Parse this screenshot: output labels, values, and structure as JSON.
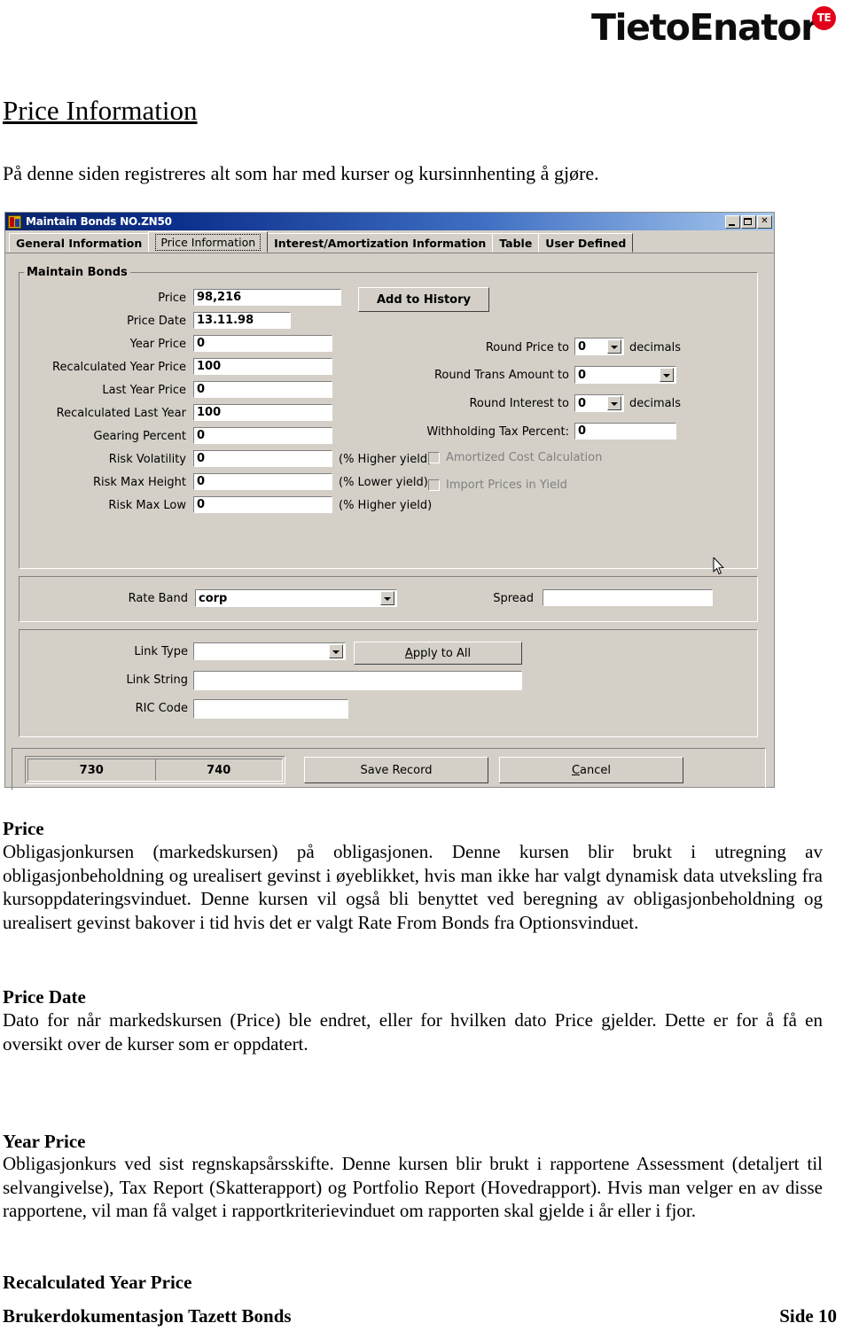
{
  "logo": {
    "wordmark": "TietoEnator",
    "badge": "TE"
  },
  "document": {
    "title": "Price Information",
    "intro": "På denne siden registreres alt som har med kurser og kursinnhenting å gjøre.",
    "sections": [
      {
        "heading": "Price",
        "body": "Obligasjonkursen (markedskursen) på obligasjonen. Denne kursen blir brukt i utregning av obligasjonbeholdning og urealisert gevinst i øyeblikket, hvis man ikke har valgt dynamisk data utveksling fra kursoppdateringsvinduet. Denne kursen vil også bli benyttet ved beregning av obligasjonbeholdning og urealisert gevinst bakover i tid hvis det er valgt Rate From Bonds fra Optionsvinduet."
      },
      {
        "heading": "Price Date",
        "body": "Dato for når markedskursen (Price) ble endret, eller for hvilken dato Price gjelder. Dette er for å få en oversikt over de kurser som er oppdatert."
      },
      {
        "heading": "Year Price",
        "body": "Obligasjonkurs ved sist regnskapsårsskifte. Denne kursen blir brukt i rapportene Assessment (detaljert til selvangivelse), Tax Report (Skatterapport) og Portfolio Report (Hovedrapport). Hvis man velger en av disse rapportene, vil man få valget i rapportkriterievinduet om rapporten skal gjelde i år eller i fjor."
      },
      {
        "heading": "Recalculated Year Price",
        "body": ""
      }
    ],
    "footer": {
      "left": "Brukerdokumentasjon Tazett Bonds",
      "right": "Side 10"
    }
  },
  "window": {
    "title": "Maintain Bonds NO.ZN50",
    "titlebar_buttons": {
      "minimize": "minimize-icon",
      "maximize": "maximize-icon",
      "close": "close-icon"
    },
    "tabs": [
      {
        "label": "General Information",
        "selected": false
      },
      {
        "label": "Price Information",
        "selected": true
      },
      {
        "label": "Interest/Amortization Information",
        "selected": false
      },
      {
        "label": "Table",
        "selected": false
      },
      {
        "label": "User Defined",
        "selected": false
      }
    ],
    "group_main": {
      "legend": "Maintain Bonds",
      "fields": [
        {
          "label": "Price",
          "value": "98,216"
        },
        {
          "label": "Price Date",
          "value": "13.11.98"
        },
        {
          "label": "Year Price",
          "value": "0"
        },
        {
          "label": "Recalculated Year Price",
          "value": "100"
        },
        {
          "label": "Last Year Price",
          "value": "0"
        },
        {
          "label": "Recalculated Last Year",
          "value": "100"
        },
        {
          "label": "Gearing Percent",
          "value": "0"
        },
        {
          "label": "Risk Volatility",
          "value": "0",
          "suffix": "(% Higher yield)"
        },
        {
          "label": "Risk Max Height",
          "value": "0",
          "suffix": "(% Lower yield)"
        },
        {
          "label": "Risk Max Low",
          "value": "0",
          "suffix": "(% Higher yield)"
        }
      ],
      "add_to_history_button": "Add to History",
      "rounding": [
        {
          "label": "Round Price to",
          "value": "0",
          "unit": "decimals"
        },
        {
          "label": "Round Trans Amount to",
          "value": "0",
          "unit": ""
        },
        {
          "label": "Round Interest to",
          "value": "0",
          "unit": "decimals"
        }
      ],
      "withholding": {
        "label": "Withholding Tax Percent:",
        "value": "0"
      },
      "checkboxes": [
        {
          "label": "Amortized Cost Calculation",
          "checked": false,
          "enabled": false
        },
        {
          "label": "Import Prices in Yield",
          "checked": false,
          "enabled": false
        }
      ]
    },
    "group_rate": {
      "rate_band_label": "Rate Band",
      "rate_band_value": "corp",
      "spread_label": "Spread",
      "spread_value": ""
    },
    "group_link": {
      "link_type_label": "Link Type",
      "link_type_value": "",
      "apply_to_all_button": "Apply to All",
      "apply_to_all_accel": "A",
      "link_string_label": "Link String",
      "link_string_value": "",
      "ric_code_label": "RIC Code",
      "ric_code_value": ""
    },
    "bottom_bar": {
      "segment_left": "730",
      "segment_right": "740",
      "save_button": "Save Record",
      "cancel_button": "Cancel",
      "cancel_accel": "C"
    }
  },
  "colors": {
    "dialog_face": "#d4d0c8",
    "titlebar_start": "#0a246a",
    "titlebar_end": "#a6c8ee",
    "logo_red": "#e2001a",
    "disabled_text": "#808080"
  }
}
